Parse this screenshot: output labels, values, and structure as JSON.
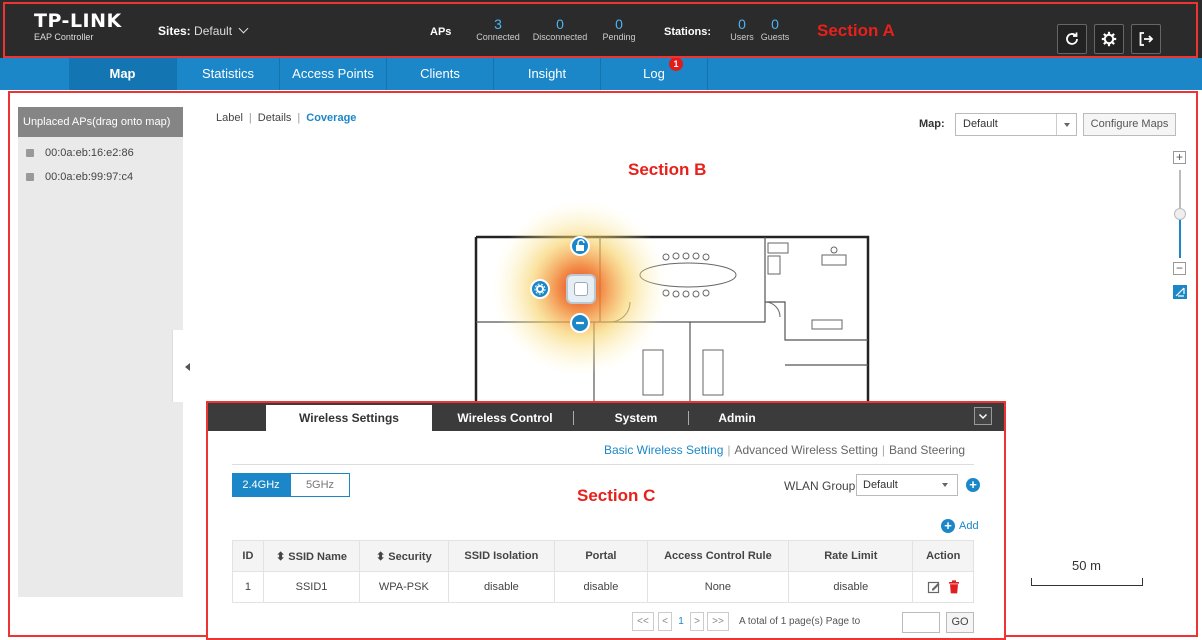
{
  "header": {
    "brand": "TP-LINK",
    "product": "EAP Controller",
    "sites_label": "Sites:",
    "sites_value": "Default",
    "aps_label": "APs",
    "aps": [
      {
        "value": "3",
        "label": "Connected"
      },
      {
        "value": "0",
        "label": "Disconnected"
      },
      {
        "value": "0",
        "label": "Pending"
      }
    ],
    "stations_label": "Stations:",
    "stations": [
      {
        "value": "0",
        "label": "Users"
      },
      {
        "value": "0",
        "label": "Guests"
      }
    ],
    "icons": [
      "refresh-icon",
      "settings-gear-icon",
      "logout-icon"
    ]
  },
  "annotations": {
    "section_a": "Section A",
    "section_b": "Section B",
    "section_c": "Section C"
  },
  "nav": {
    "items": [
      "Map",
      "Statistics",
      "Access Points",
      "Clients",
      "Insight",
      "Log"
    ],
    "active": "Map",
    "log_badge": "1"
  },
  "sidebar": {
    "title": "Unplaced APs(drag onto map)",
    "aps": [
      "00:0a:eb:16:e2:86",
      "00:0a:eb:99:97:c4"
    ]
  },
  "map": {
    "view_tabs": [
      "Label",
      "Details",
      "Coverage"
    ],
    "active_view": "Coverage",
    "map_label": "Map:",
    "map_select": "Default",
    "configure_button": "Configure Maps",
    "scale": "50 m"
  },
  "panel": {
    "tabs": [
      "Wireless Settings",
      "Wireless Control",
      "System",
      "Admin"
    ],
    "active_tab": "Wireless Settings",
    "sublinks": [
      "Basic Wireless Setting",
      "Advanced Wireless Setting",
      "Band Steering"
    ],
    "active_sublink": "Basic Wireless Setting",
    "bands": [
      "2.4GHz",
      "5GHz"
    ],
    "active_band": "2.4GHz",
    "wlan_group_label": "WLAN Group",
    "wlan_group_value": "Default",
    "add_label": "Add",
    "table": {
      "headers": [
        "ID",
        "⬍ SSID Name",
        "⬍ Security",
        "SSID Isolation",
        "Portal",
        "Access Control Rule",
        "Rate Limit",
        "Action"
      ],
      "rows": [
        [
          "1",
          "SSID1",
          "WPA-PSK",
          "disable",
          "disable",
          "None",
          "disable",
          ""
        ]
      ]
    },
    "pager": {
      "first": "<<",
      "prev": "<",
      "current": "1",
      "next": ">",
      "last": ">>",
      "summary": "A total of 1 page(s)  Page to",
      "go": "GO"
    }
  },
  "colors": {
    "topbar": "#2b2b2b",
    "nav": "#1b87c8",
    "accent": "#1b87c8",
    "annotation": "#e8201b"
  }
}
